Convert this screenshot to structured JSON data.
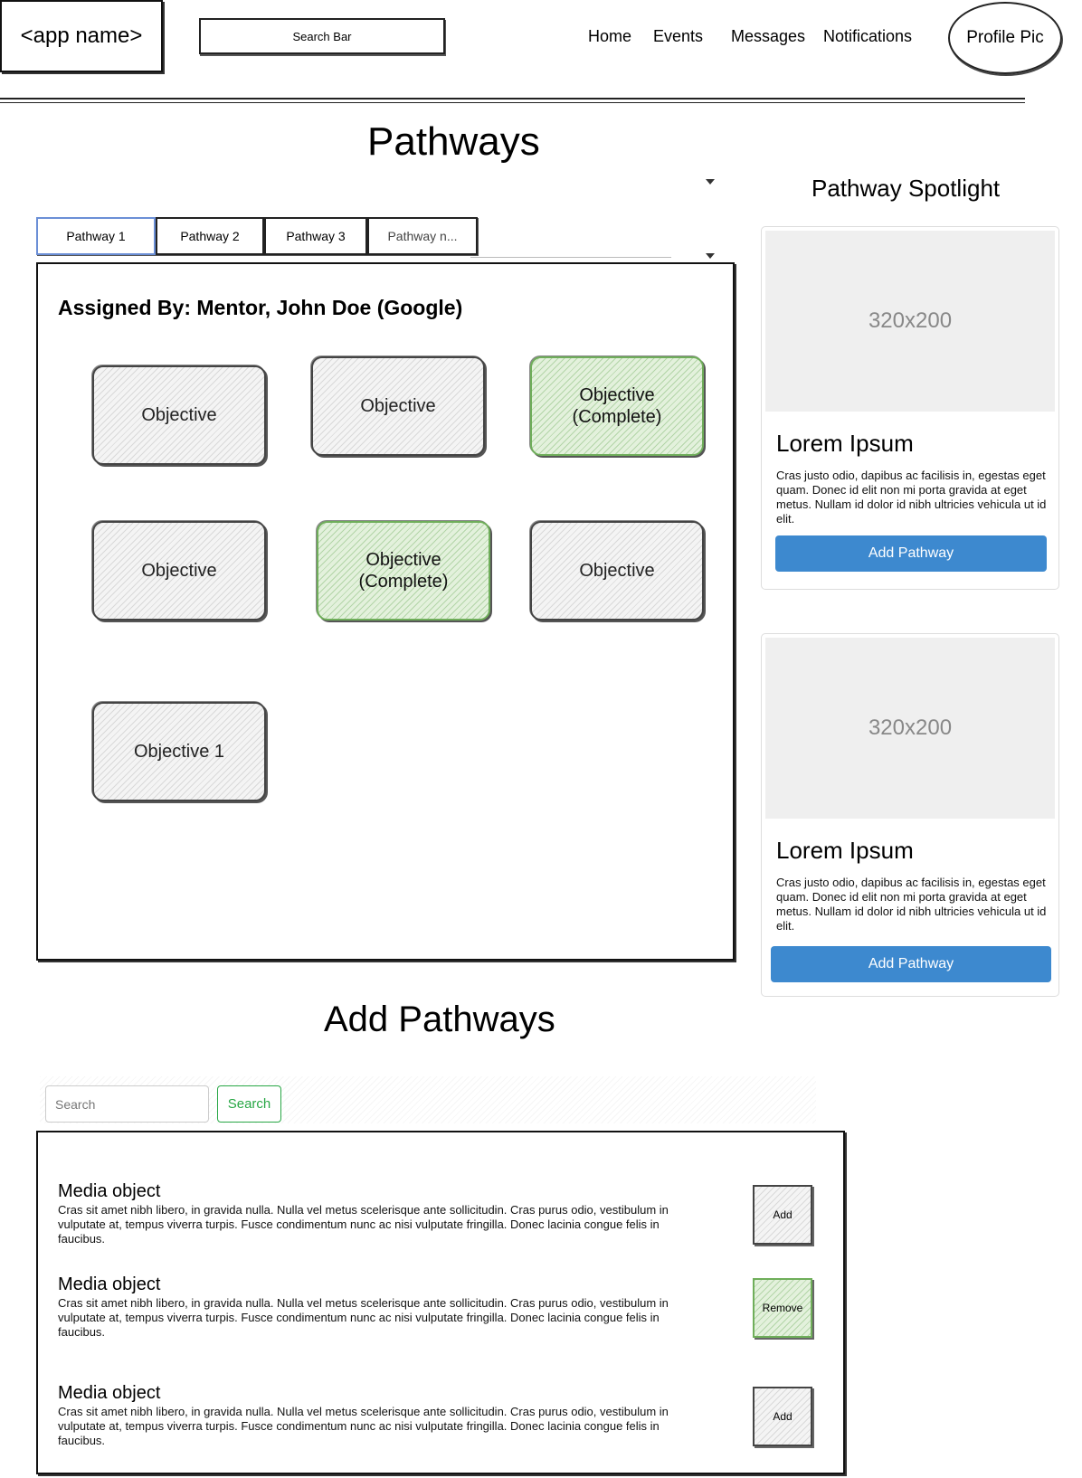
{
  "header": {
    "app_name": "<app name>",
    "search_label": "Search Bar",
    "nav": [
      "Home",
      "Events",
      "Messages",
      "Notifications"
    ],
    "profile_label": "Profile Pic"
  },
  "pathways": {
    "title": "Pathways",
    "tabs": [
      "Pathway 1",
      "Pathway 2",
      "Pathway 3",
      "Pathway n..."
    ],
    "active_tab": "Pathway 1",
    "assigned_by": "Assigned By: Mentor, John Doe (Google)",
    "objectives": [
      {
        "label": "Objective",
        "status": "incomplete"
      },
      {
        "label": "Objective",
        "status": "incomplete"
      },
      {
        "label": "Objective (Complete)",
        "status": "complete"
      },
      {
        "label": "Objective",
        "status": "incomplete"
      },
      {
        "label": "Objective (Complete)",
        "status": "complete"
      },
      {
        "label": "Objective",
        "status": "incomplete"
      },
      {
        "label": "Objective 1",
        "status": "incomplete"
      }
    ]
  },
  "spotlight": {
    "title": "Pathway Spotlight",
    "cards": [
      {
        "image_label": "320x200",
        "title": "Lorem Ipsum",
        "text": "Cras justo odio, dapibus ac facilisis in, egestas eget quam. Donec id elit non mi porta gravida at eget metus. Nullam id dolor id nibh ultricies vehicula ut id elit.",
        "button": "Add Pathway"
      },
      {
        "image_label": "320x200",
        "title": "Lorem Ipsum",
        "text": "Cras justo odio, dapibus ac facilisis in, egestas eget quam. Donec id elit non mi porta gravida at eget metus. Nullam id dolor id nibh ultricies vehicula ut id elit.",
        "button": "Add Pathway"
      }
    ]
  },
  "add_pathways": {
    "title": "Add Pathways",
    "search_placeholder": "Search",
    "search_button": "Search",
    "items": [
      {
        "title": "Media object",
        "body": "Cras sit amet nibh libero, in gravida nulla. Nulla vel metus scelerisque ante sollicitudin. Cras purus odio, vestibulum in vulputate at, tempus viverra turpis. Fusce condimentum nunc ac nisi vulputate fringilla. Donec lacinia congue felis in faucibus.",
        "action": "Add"
      },
      {
        "title": "Media object",
        "body": "Cras sit amet nibh libero, in gravida nulla. Nulla vel metus scelerisque ante sollicitudin. Cras purus odio, vestibulum in vulputate at, tempus viverra turpis. Fusce condimentum nunc ac nisi vulputate fringilla. Donec lacinia congue felis in faucibus.",
        "action": "Remove"
      },
      {
        "title": "Media object",
        "body": "Cras sit amet nibh libero, in gravida nulla. Nulla vel metus scelerisque ante sollicitudin. Cras purus odio, vestibulum in vulputate at, tempus viverra turpis. Fusce condimentum nunc ac nisi vulputate fringilla. Donec lacinia congue felis in faucibus.",
        "action": "Add"
      }
    ]
  },
  "colors": {
    "primary_button": "#3d89cf",
    "complete_green": "#6fae5a",
    "search_green": "#28a745"
  }
}
